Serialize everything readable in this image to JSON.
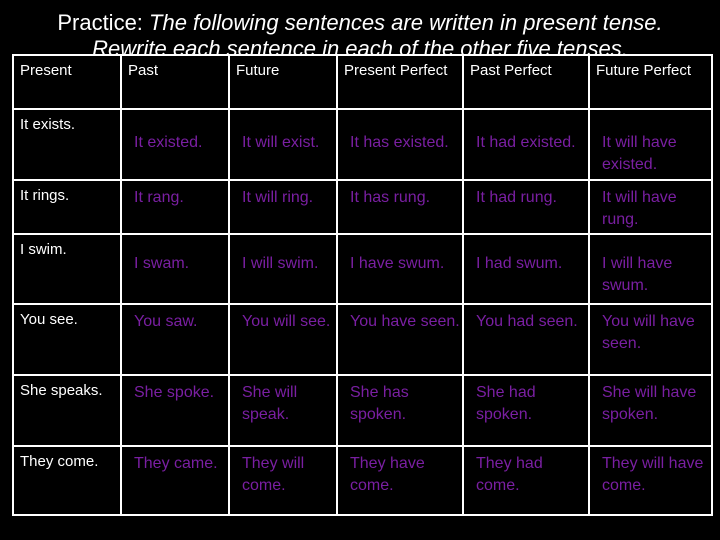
{
  "title": {
    "prefix": "Practice: ",
    "line1_italic": "The following sentences are written in present tense.",
    "line2_italic": "Rewrite each sentence in each of the other five tenses."
  },
  "colors": {
    "background": "#000000",
    "text": "#ffffff",
    "answer": "#7a1fa2",
    "border": "#ffffff"
  },
  "table": {
    "headers": [
      "Present",
      "Past",
      "Future",
      "Present Perfect",
      "Past Perfect",
      "Future Perfect"
    ],
    "rows": [
      [
        "It exists.",
        "It existed.",
        "It will exist.",
        "It has existed.",
        "It had existed.",
        "It will have existed."
      ],
      [
        "It rings.",
        "It rang.",
        "It will ring.",
        "It has rung.",
        "It had rung.",
        "It will have rung."
      ],
      [
        "I swim.",
        "I swam.",
        "I will swim.",
        "I have swum.",
        "I had swum.",
        "I will have swum."
      ],
      [
        "You see.",
        "You saw.",
        "You will see.",
        "You have seen.",
        "You had seen.",
        "You will have seen."
      ],
      [
        "She speaks.",
        "She spoke.",
        "She will speak.",
        "She has spoken.",
        "She had spoken.",
        "She will have spoken."
      ],
      [
        "They come.",
        "They came.",
        "They will come.",
        "They have come.",
        "They had come.",
        "They will have come."
      ]
    ]
  }
}
